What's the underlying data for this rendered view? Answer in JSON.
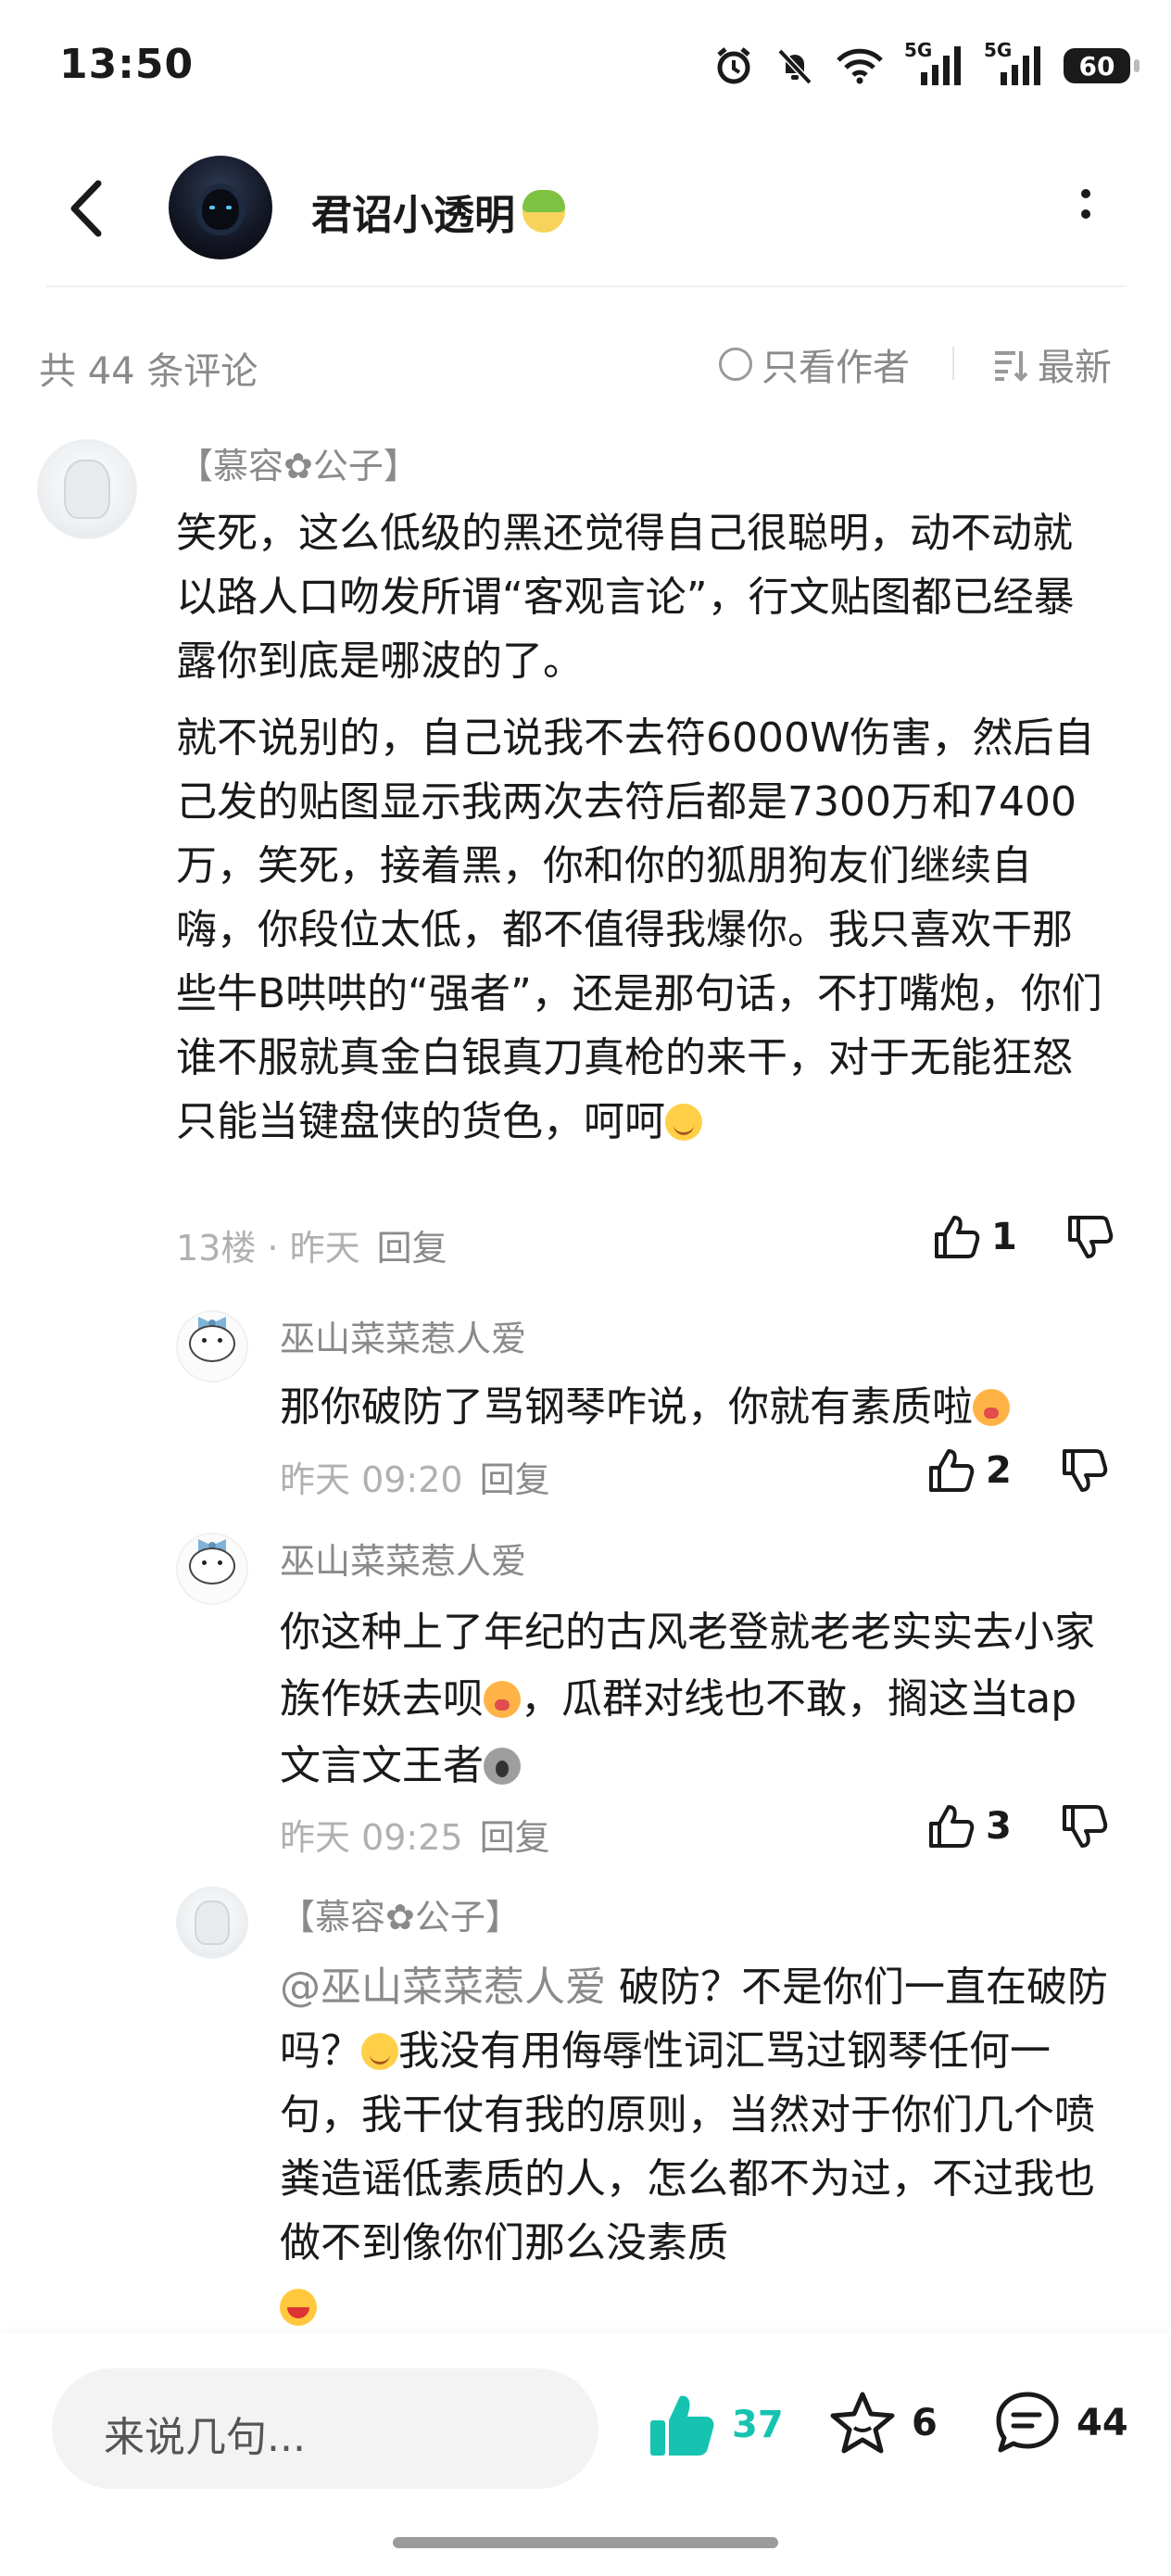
{
  "status_bar": {
    "time": "13:50",
    "network_1": "5G",
    "network_2": "5G",
    "battery": "60"
  },
  "header": {
    "author_name": "君诏小透明"
  },
  "sort_bar": {
    "count_text": "共 44 条评论",
    "only_author": "只看作者",
    "sort_label": "最新"
  },
  "comments": [
    {
      "nickname": "【慕容✿公子】",
      "paragraph_1": "笑死，这么低级的黑还觉得自己很聪明，动不动就以路人口吻发所谓“客观言论”，行文贴图都已经暴露你到底是哪波的了。",
      "paragraph_2": "就不说别的，自己说我不去符6000W伤害，然后自己发的贴图显示我两次去符后都是7300万和7400万，笑死，接着黑，你和你的狐朋狗友们继续自嗨，你段位太低，都不值得我爆你。我只喜欢干那些牛B哄哄的“强者”，还是那句话，不打嘴炮，你们谁不服就真金白银真刀真枪的来干，对于无能狂怒只能当键盘侠的货色，呵呵",
      "floor_time": "13楼 · 昨天",
      "reply_label": "回复",
      "likes": "1"
    }
  ],
  "replies": [
    {
      "nickname": "巫山菜菜惹人爱",
      "text": "那你破防了骂钢琴咋说，你就有素质啦",
      "time": "昨天 09:20",
      "reply_label": "回复",
      "likes": "2"
    },
    {
      "nickname": "巫山菜菜惹人爱",
      "text_a": "你这种上了年纪的古风老登就老老实实去小家族作妖去呗",
      "text_b": "，瓜群对线也不敢，搁这当tap文言文王者",
      "time": "昨天 09:25",
      "reply_label": "回复",
      "likes": "3"
    },
    {
      "nickname": "【慕容✿公子】",
      "mention": "@巫山菜菜惹人爱",
      "text_a": " 破防？不是你们一直在破防吗？",
      "text_b": "我没有用侮辱性词汇骂过钢琴任何一句，我干仗有我的原则，当然对于你们几个喷粪造谣低素质的人，怎么都不为过，不过我也做不到像你们那么没素质"
    }
  ],
  "bottom_bar": {
    "input_placeholder": "来说几句...",
    "like_count": "37",
    "fav_count": "6",
    "comment_count": "44"
  },
  "colors": {
    "accent": "#16c3b0",
    "muted_text": "#8a8a8a",
    "light_text": "#b0b0b0"
  }
}
